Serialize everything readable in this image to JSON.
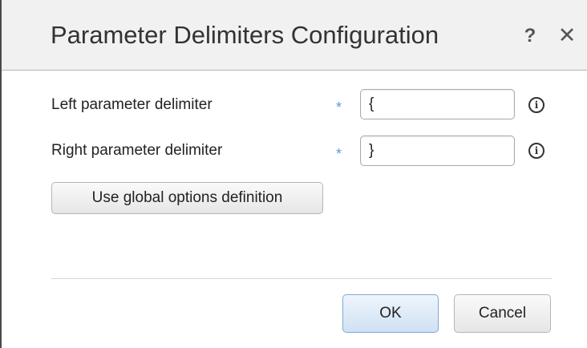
{
  "dialog": {
    "title": "Parameter Delimiters Configuration",
    "help_label": "?",
    "close_label": "✕"
  },
  "form": {
    "left": {
      "label": "Left parameter delimiter",
      "required_mark": "*",
      "value": "{",
      "info_icon": "i"
    },
    "right": {
      "label": "Right parameter delimiter",
      "required_mark": "*",
      "value": "}",
      "info_icon": "i"
    },
    "global_button_label": "Use global options definition"
  },
  "footer": {
    "ok_label": "OK",
    "cancel_label": "Cancel"
  },
  "colors": {
    "required_mark": "#5b9bd5",
    "ok_button_border": "#7fa9cf"
  }
}
